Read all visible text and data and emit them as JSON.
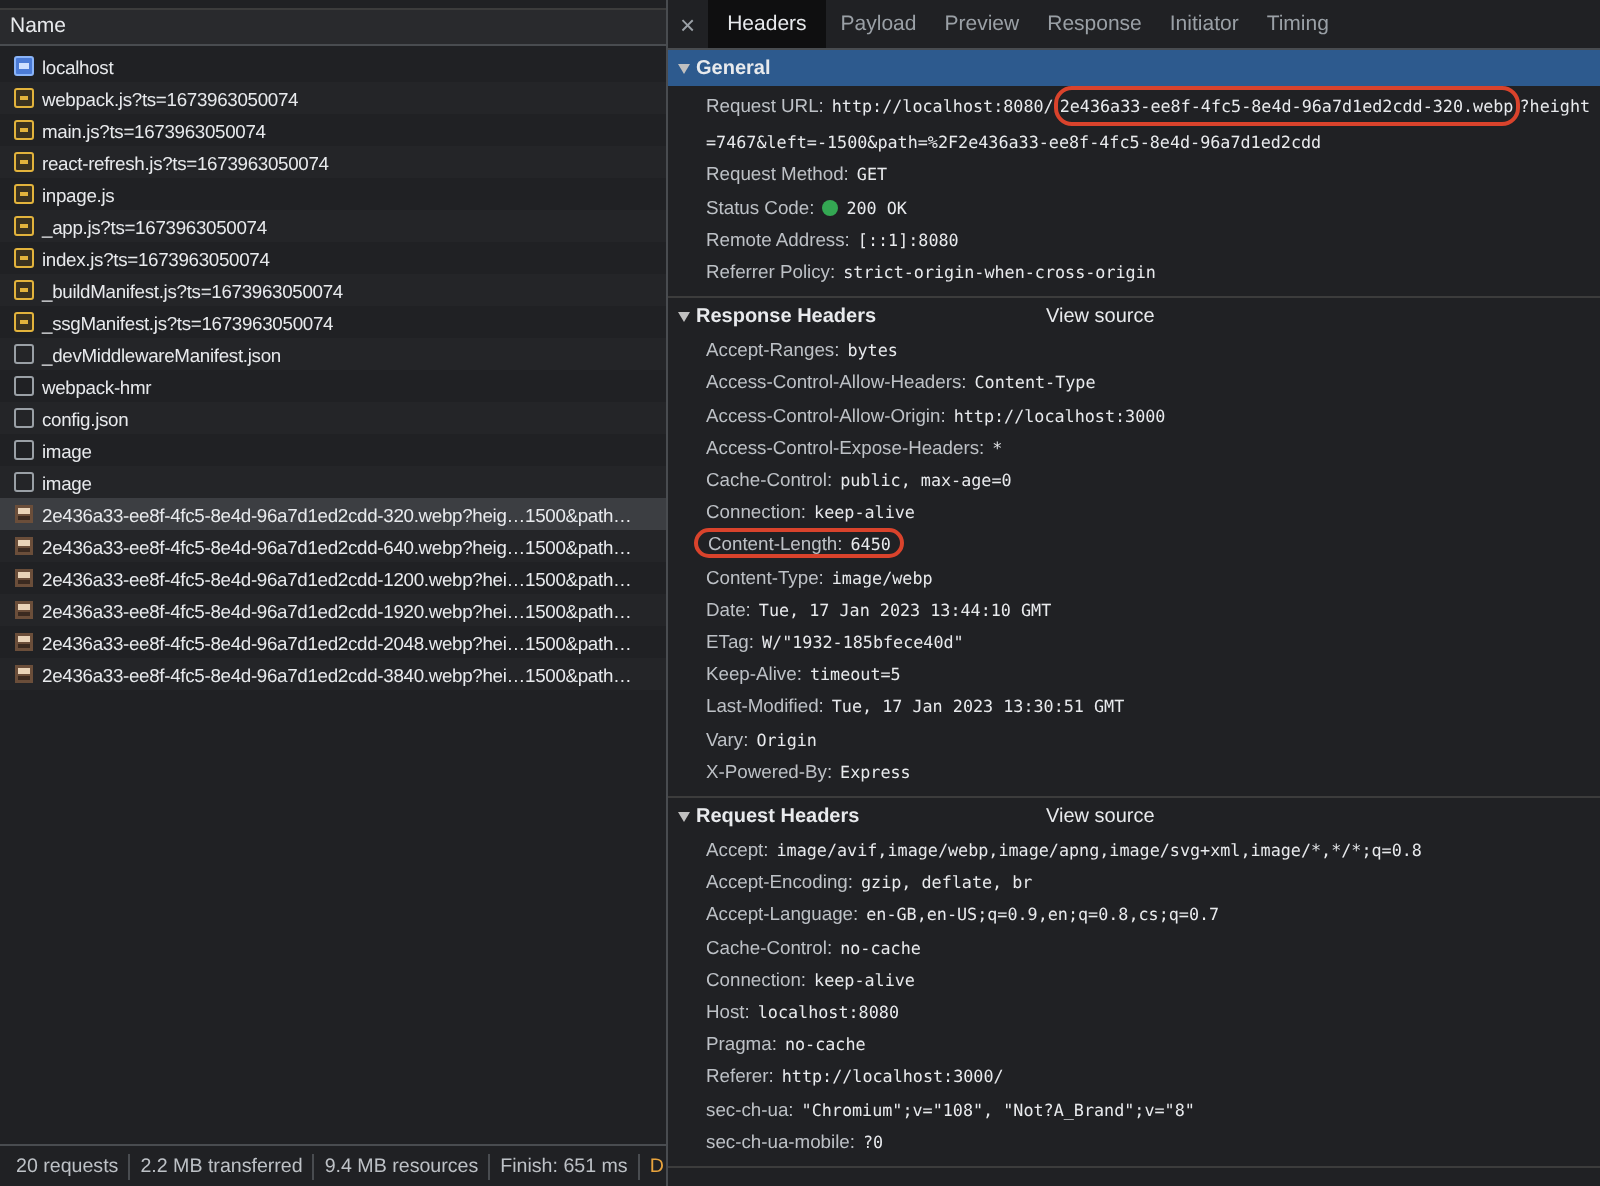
{
  "request_list": {
    "column_header": "Name",
    "rows": [
      {
        "name": "localhost",
        "kind": "document",
        "selected": false
      },
      {
        "name": "webpack.js?ts=1673963050074",
        "kind": "script",
        "selected": false
      },
      {
        "name": "main.js?ts=1673963050074",
        "kind": "script",
        "selected": false
      },
      {
        "name": "react-refresh.js?ts=1673963050074",
        "kind": "script",
        "selected": false
      },
      {
        "name": "inpage.js",
        "kind": "script",
        "selected": false
      },
      {
        "name": "_app.js?ts=1673963050074",
        "kind": "script",
        "selected": false
      },
      {
        "name": "index.js?ts=1673963050074",
        "kind": "script",
        "selected": false
      },
      {
        "name": "_buildManifest.js?ts=1673963050074",
        "kind": "script",
        "selected": false
      },
      {
        "name": "_ssgManifest.js?ts=1673963050074",
        "kind": "script",
        "selected": false
      },
      {
        "name": "_devMiddlewareManifest.json",
        "kind": "other",
        "selected": false
      },
      {
        "name": "webpack-hmr",
        "kind": "other",
        "selected": false
      },
      {
        "name": "config.json",
        "kind": "other",
        "selected": false
      },
      {
        "name": "image",
        "kind": "other",
        "selected": false
      },
      {
        "name": "image",
        "kind": "other",
        "selected": false
      },
      {
        "name": "2e436a33-ee8f-4fc5-8e4d-96a7d1ed2cdd-320.webp?heig…1500&path…",
        "kind": "image",
        "selected": true
      },
      {
        "name": "2e436a33-ee8f-4fc5-8e4d-96a7d1ed2cdd-640.webp?heig…1500&path…",
        "kind": "image",
        "selected": false
      },
      {
        "name": "2e436a33-ee8f-4fc5-8e4d-96a7d1ed2cdd-1200.webp?hei…1500&path…",
        "kind": "image",
        "selected": false
      },
      {
        "name": "2e436a33-ee8f-4fc5-8e4d-96a7d1ed2cdd-1920.webp?hei…1500&path…",
        "kind": "image",
        "selected": false
      },
      {
        "name": "2e436a33-ee8f-4fc5-8e4d-96a7d1ed2cdd-2048.webp?hei…1500&path…",
        "kind": "image",
        "selected": false
      },
      {
        "name": "2e436a33-ee8f-4fc5-8e4d-96a7d1ed2cdd-3840.webp?hei…1500&path…",
        "kind": "image",
        "selected": false
      }
    ]
  },
  "status_bar": [
    {
      "text": "20 requests",
      "color": "#bdc1c6"
    },
    {
      "text": "2.2 MB transferred",
      "color": "#bdc1c6"
    },
    {
      "text": "9.4 MB resources",
      "color": "#bdc1c6"
    },
    {
      "text": "Finish: 651 ms",
      "color": "#bdc1c6"
    },
    {
      "text": "D",
      "color": "#e8a33d"
    }
  ],
  "detail": {
    "close": "×",
    "tabs": [
      {
        "label": "Headers",
        "selected": true
      },
      {
        "label": "Payload",
        "selected": false
      },
      {
        "label": "Preview",
        "selected": false
      },
      {
        "label": "Response",
        "selected": false
      },
      {
        "label": "Initiator",
        "selected": false
      },
      {
        "label": "Timing",
        "selected": false
      }
    ],
    "sections": [
      {
        "title": "General",
        "expanded": true,
        "selected": true,
        "items": [
          {
            "name": "Request URL:",
            "circled": false,
            "segments": [
              {
                "text": "http://localhost:8080/",
                "circled": false
              },
              {
                "text": "2e436a33-ee8f-4fc5-8e4d-96a7d1ed2cdd-320.webp",
                "circled": true
              },
              {
                "text": "?height",
                "circled": false
              },
              {
                "text": "=7467&left=-1500&path=%2F2e436a33-ee8f-4fc5-8e4d-96a7d1ed2cdd",
                "circled": false
              }
            ]
          },
          {
            "name": "Request Method:",
            "circled": false,
            "segments": [
              {
                "text": "GET",
                "circled": false
              }
            ]
          },
          {
            "name": "Status Code:",
            "circled": false,
            "status_dot": true,
            "segments": [
              {
                "text": "200 OK",
                "circled": false
              }
            ]
          },
          {
            "name": "Remote Address:",
            "circled": false,
            "segments": [
              {
                "text": "[::1]:8080",
                "circled": false
              }
            ]
          },
          {
            "name": "Referrer Policy:",
            "circled": false,
            "segments": [
              {
                "text": "strict-origin-when-cross-origin",
                "circled": false
              }
            ]
          }
        ]
      },
      {
        "title": "Response Headers",
        "expanded": true,
        "selected": false,
        "action": "View source",
        "items": [
          {
            "name": "Accept-Ranges:",
            "circled": false,
            "segments": [
              {
                "text": "bytes",
                "circled": false
              }
            ]
          },
          {
            "name": "Access-Control-Allow-Headers:",
            "circled": false,
            "segments": [
              {
                "text": "Content-Type",
                "circled": false
              }
            ]
          },
          {
            "name": "Access-Control-Allow-Origin:",
            "circled": false,
            "segments": [
              {
                "text": "http://localhost:3000",
                "circled": false
              }
            ]
          },
          {
            "name": "Access-Control-Expose-Headers:",
            "circled": false,
            "segments": [
              {
                "text": "*",
                "circled": false
              }
            ]
          },
          {
            "name": "Cache-Control:",
            "circled": false,
            "segments": [
              {
                "text": "public, max-age=0",
                "circled": false
              }
            ]
          },
          {
            "name": "Connection:",
            "circled": false,
            "segments": [
              {
                "text": "keep-alive",
                "circled": false
              }
            ]
          },
          {
            "name": "Content-Length:",
            "circled": true,
            "segments": [
              {
                "text": "6450",
                "circled": false
              }
            ]
          },
          {
            "name": "Content-Type:",
            "circled": false,
            "segments": [
              {
                "text": "image/webp",
                "circled": false
              }
            ]
          },
          {
            "name": "Date:",
            "circled": false,
            "segments": [
              {
                "text": "Tue, 17 Jan 2023 13:44:10 GMT",
                "circled": false
              }
            ]
          },
          {
            "name": "ETag:",
            "circled": false,
            "segments": [
              {
                "text": "W/\"1932-185bfece40d\"",
                "circled": false
              }
            ]
          },
          {
            "name": "Keep-Alive:",
            "circled": false,
            "segments": [
              {
                "text": "timeout=5",
                "circled": false
              }
            ]
          },
          {
            "name": "Last-Modified:",
            "circled": false,
            "segments": [
              {
                "text": "Tue, 17 Jan 2023 13:30:51 GMT",
                "circled": false
              }
            ]
          },
          {
            "name": "Vary:",
            "circled": false,
            "segments": [
              {
                "text": "Origin",
                "circled": false
              }
            ]
          },
          {
            "name": "X-Powered-By:",
            "circled": false,
            "segments": [
              {
                "text": "Express",
                "circled": false
              }
            ]
          }
        ]
      },
      {
        "title": "Request Headers",
        "expanded": true,
        "selected": false,
        "action": "View source",
        "items": [
          {
            "name": "Accept:",
            "circled": false,
            "segments": [
              {
                "text": "image/avif,image/webp,image/apng,image/svg+xml,image/*,*/*;q=0.8",
                "circled": false
              }
            ]
          },
          {
            "name": "Accept-Encoding:",
            "circled": false,
            "segments": [
              {
                "text": "gzip, deflate, br",
                "circled": false
              }
            ]
          },
          {
            "name": "Accept-Language:",
            "circled": false,
            "segments": [
              {
                "text": "en-GB,en-US;q=0.9,en;q=0.8,cs;q=0.7",
                "circled": false
              }
            ]
          },
          {
            "name": "Cache-Control:",
            "circled": false,
            "segments": [
              {
                "text": "no-cache",
                "circled": false
              }
            ]
          },
          {
            "name": "Connection:",
            "circled": false,
            "segments": [
              {
                "text": "keep-alive",
                "circled": false
              }
            ]
          },
          {
            "name": "Host:",
            "circled": false,
            "segments": [
              {
                "text": "localhost:8080",
                "circled": false
              }
            ]
          },
          {
            "name": "Pragma:",
            "circled": false,
            "segments": [
              {
                "text": "no-cache",
                "circled": false
              }
            ]
          },
          {
            "name": "Referer:",
            "circled": false,
            "segments": [
              {
                "text": "http://localhost:3000/",
                "circled": false
              }
            ]
          },
          {
            "name": "sec-ch-ua:",
            "circled": false,
            "segments": [
              {
                "text": "\"Chromium\";v=\"108\", \"Not?A_Brand\";v=\"8\"",
                "circled": false
              }
            ]
          },
          {
            "name": "sec-ch-ua-mobile:",
            "circled": false,
            "segments": [
              {
                "text": "?0",
                "circled": false
              }
            ]
          }
        ]
      }
    ]
  }
}
